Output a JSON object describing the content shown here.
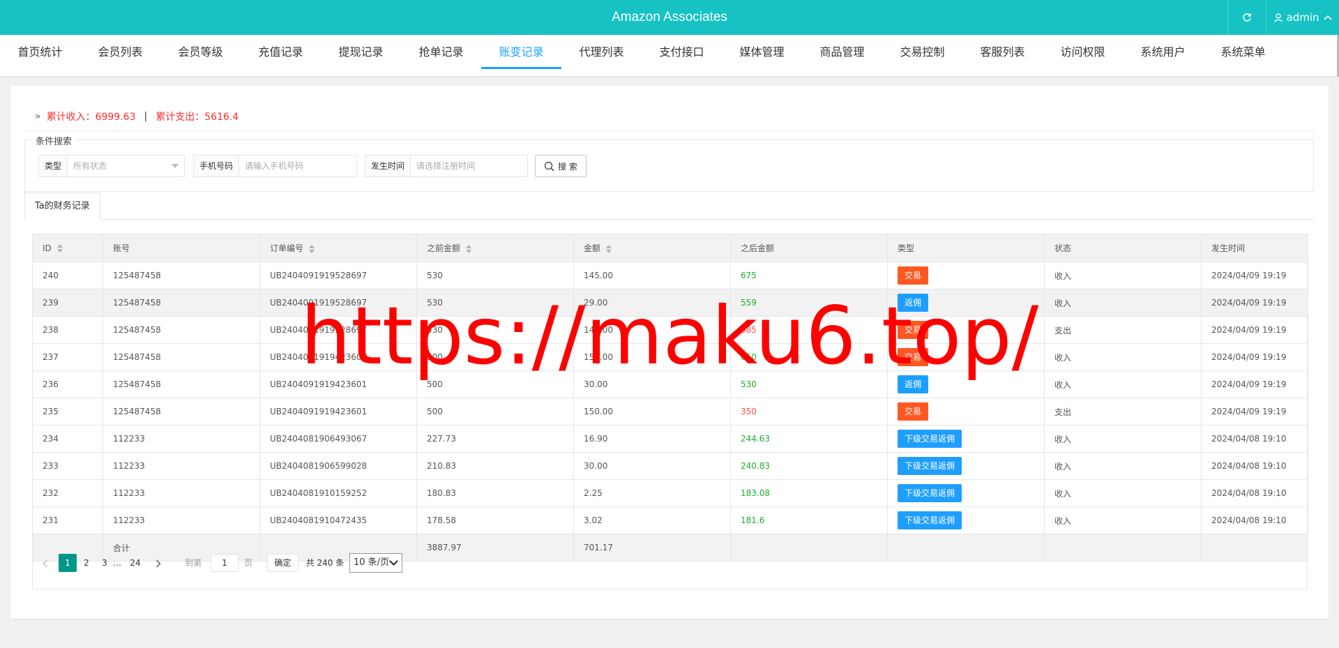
{
  "app": {
    "title": "Amazon Associates",
    "user_label": "admin"
  },
  "nav": {
    "items": [
      "首页统计",
      "会员列表",
      "会员等级",
      "充值记录",
      "提现记录",
      "抢单记录",
      "账变记录",
      "代理列表",
      "支付接口",
      "媒体管理",
      "商品管理",
      "交易控制",
      "客服列表",
      "访问权限",
      "系统用户",
      "系统菜单"
    ],
    "active_index": 6
  },
  "summary": {
    "income_label": "累计收入：6999.63",
    "separator": "|",
    "expense_label": "累计支出：5616.4"
  },
  "search": {
    "legend": "条件搜索",
    "type_label": "类型",
    "type_value": "所有状态",
    "phone_label": "手机号码",
    "phone_placeholder": "请输入手机号码",
    "time_label": "发生时间",
    "time_placeholder": "请选择注册时间",
    "button_label": "搜 索"
  },
  "tab": {
    "label": "Ta的财务记录"
  },
  "table": {
    "headers": [
      "ID",
      "账号",
      "订单编号",
      "之前金额",
      "金额",
      "之后金额",
      "类型",
      "状态",
      "发生时间"
    ],
    "rows": [
      {
        "id": "240",
        "account": "125487458",
        "order": "UB2404091919528697",
        "before": "530",
        "amount": "145.00",
        "after": "675",
        "after_color": "green",
        "type": "交易",
        "type_color": "orange",
        "status": "收入",
        "time": "2024/04/09 19:19"
      },
      {
        "id": "239",
        "account": "125487458",
        "order": "UB2404091919528697",
        "before": "530",
        "amount": "29.00",
        "after": "559",
        "after_color": "green",
        "type": "返佣",
        "type_color": "blue",
        "status": "收入",
        "time": "2024/04/09 19:19"
      },
      {
        "id": "238",
        "account": "125487458",
        "order": "UB2404091919528697",
        "before": "530",
        "amount": "145.00",
        "after": "385",
        "after_color": "red",
        "type": "交易",
        "type_color": "orange",
        "status": "支出",
        "time": "2024/04/09 19:19"
      },
      {
        "id": "237",
        "account": "125487458",
        "order": "UB2404091919423601",
        "before": "500",
        "amount": "150.00",
        "after": "650",
        "after_color": "green",
        "type": "交易",
        "type_color": "orange",
        "status": "收入",
        "time": "2024/04/09 19:19"
      },
      {
        "id": "236",
        "account": "125487458",
        "order": "UB2404091919423601",
        "before": "500",
        "amount": "30.00",
        "after": "530",
        "after_color": "green",
        "type": "返佣",
        "type_color": "blue",
        "status": "收入",
        "time": "2024/04/09 19:19"
      },
      {
        "id": "235",
        "account": "125487458",
        "order": "UB2404091919423601",
        "before": "500",
        "amount": "150.00",
        "after": "350",
        "after_color": "red",
        "type": "交易",
        "type_color": "orange",
        "status": "支出",
        "time": "2024/04/09 19:19"
      },
      {
        "id": "234",
        "account": "112233",
        "order": "UB2404081906493067",
        "before": "227.73",
        "amount": "16.90",
        "after": "244.63",
        "after_color": "green",
        "type": "下级交易返佣",
        "type_color": "blue",
        "status": "收入",
        "time": "2024/04/08 19:10"
      },
      {
        "id": "233",
        "account": "112233",
        "order": "UB2404081906599028",
        "before": "210.83",
        "amount": "30.00",
        "after": "240.83",
        "after_color": "green",
        "type": "下级交易返佣",
        "type_color": "blue",
        "status": "收入",
        "time": "2024/04/08 19:10"
      },
      {
        "id": "232",
        "account": "112233",
        "order": "UB2404081910159252",
        "before": "180.83",
        "amount": "2.25",
        "after": "183.08",
        "after_color": "green",
        "type": "下级交易返佣",
        "type_color": "blue",
        "status": "收入",
        "time": "2024/04/08 19:10"
      },
      {
        "id": "231",
        "account": "112233",
        "order": "UB2404081910472435",
        "before": "178.58",
        "amount": "3.02",
        "after": "181.6",
        "after_color": "green",
        "type": "下级交易返佣",
        "type_color": "blue",
        "status": "收入",
        "time": "2024/04/08 19:10"
      }
    ],
    "total": {
      "label": "合计",
      "before": "3887.97",
      "amount": "701.17"
    }
  },
  "pagination": {
    "pages": [
      "1",
      "2",
      "3",
      "…",
      "24"
    ],
    "current": "1",
    "goto_label": "到第",
    "goto_value": "1",
    "page_unit": "页",
    "confirm_label": "确定",
    "total_label": "共 240 条",
    "page_size_label": "10 条/页"
  },
  "watermark": {
    "text": "https://maku6.top/"
  },
  "colors": {
    "topbar": "#16c2c3",
    "active_nav": "#1e9fff",
    "summary_red": "#ff2d2d",
    "income_green": "#1aaf2b",
    "expense_red": "#ff4a4a",
    "badge_orange": "#ff5722",
    "badge_blue": "#1e9fff",
    "page_current": "#009688"
  }
}
